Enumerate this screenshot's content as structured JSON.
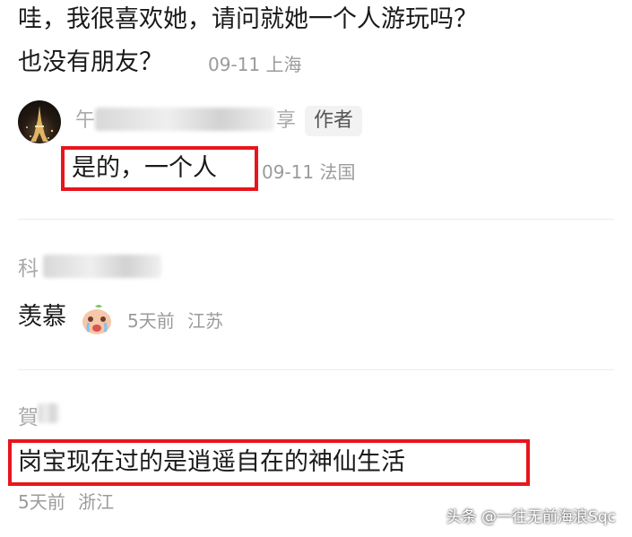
{
  "comment_top": {
    "line1": "哇，我很喜欢她，请问就她一个人游玩吗？",
    "line2": "也没有朋友？",
    "date": "09-11",
    "location": "上海"
  },
  "reply_author": {
    "name_visible_start": "午",
    "name_visible_end": "享",
    "author_tag": "作者",
    "text": "是的，一个人",
    "date": "09-11",
    "location": "法国"
  },
  "comment_2": {
    "name_visible": "科",
    "text": "羡慕",
    "emoji": "crying-face-emoji",
    "date": "5天前",
    "location": "江苏"
  },
  "comment_3": {
    "name_visible": "賀",
    "text": "岗宝现在过的是逍遥自在的神仙生活",
    "date": "5天前",
    "location": "浙江"
  },
  "watermark": "头条 @一往无前海浪Sqc",
  "colors": {
    "highlight_red": "#e8151d",
    "meta_gray": "#9b9b9b"
  }
}
